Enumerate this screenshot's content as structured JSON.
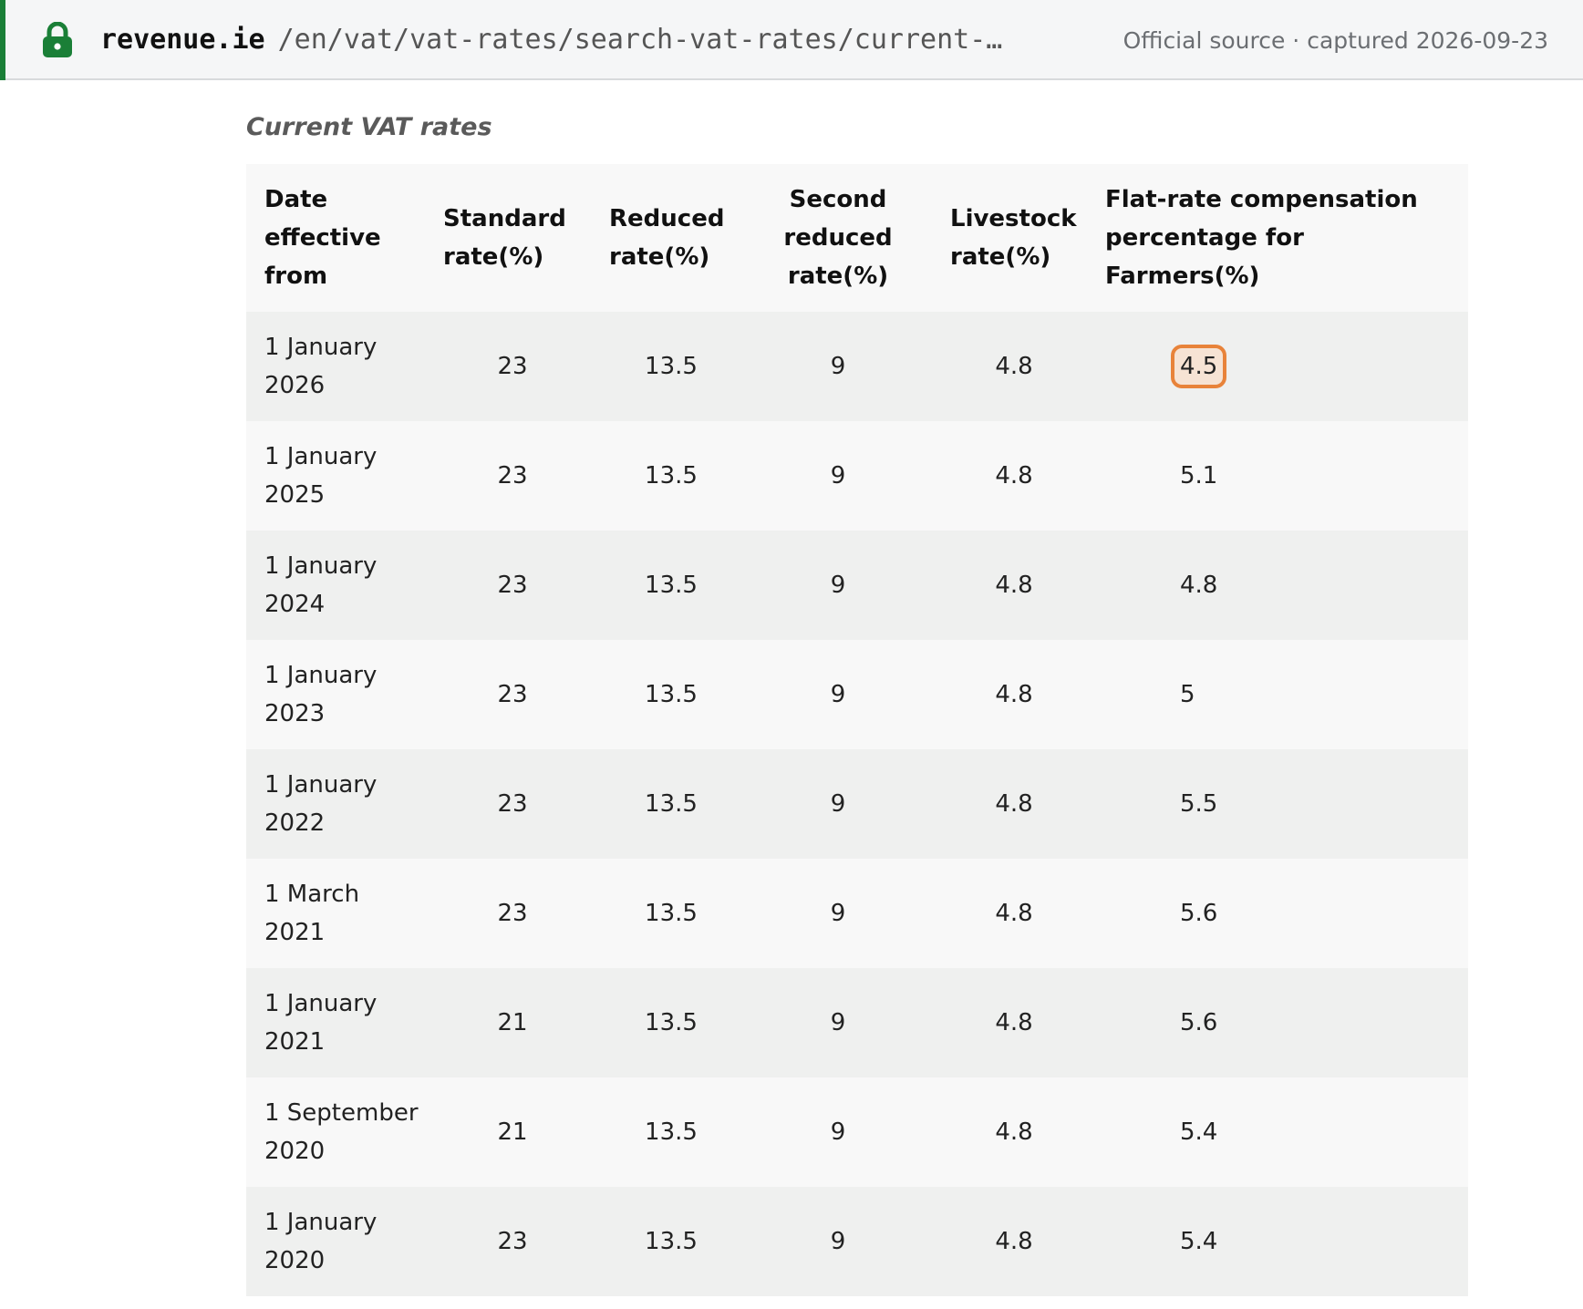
{
  "urlbar": {
    "domain": "revenue.ie",
    "path": "/en/vat/vat-rates/search-vat-rates/current-…",
    "source_note": "Official source · captured 2026-09-23",
    "accent_color": "#1a7f37",
    "lock_icon": "lock-icon"
  },
  "caption": "Current VAT rates",
  "table": {
    "headers": [
      "Date\neffective\nfrom",
      "Standard\nrate(%)",
      "Reduced\nrate(%)",
      "Second\nreduced\nrate(%)",
      "Livestock\nrate(%)",
      "Flat-rate compensation\npercentage for\nFarmers(%)"
    ],
    "rows": [
      {
        "date": "1 January\n2026",
        "standard": "23",
        "reduced": "13.5",
        "second_reduced": "9",
        "livestock": "4.8",
        "flat_rate": "4.5"
      },
      {
        "date": "1 January\n2025",
        "standard": "23",
        "reduced": "13.5",
        "second_reduced": "9",
        "livestock": "4.8",
        "flat_rate": "5.1"
      },
      {
        "date": "1 January\n2024",
        "standard": "23",
        "reduced": "13.5",
        "second_reduced": "9",
        "livestock": "4.8",
        "flat_rate": "4.8"
      },
      {
        "date": "1 January\n2023",
        "standard": "23",
        "reduced": "13.5",
        "second_reduced": "9",
        "livestock": "4.8",
        "flat_rate": "5"
      },
      {
        "date": "1 January\n2022",
        "standard": "23",
        "reduced": "13.5",
        "second_reduced": "9",
        "livestock": "4.8",
        "flat_rate": "5.5"
      },
      {
        "date": "1 March\n2021",
        "standard": "23",
        "reduced": "13.5",
        "second_reduced": "9",
        "livestock": "4.8",
        "flat_rate": "5.6"
      },
      {
        "date": "1  January\n2021",
        "standard": "21",
        "reduced": "13.5",
        "second_reduced": "9",
        "livestock": "4.8",
        "flat_rate": "5.6"
      },
      {
        "date": "1 September\n2020",
        "standard": "21",
        "reduced": "13.5",
        "second_reduced": "9",
        "livestock": "4.8",
        "flat_rate": "5.4"
      },
      {
        "date": "1 January\n2020",
        "standard": "23",
        "reduced": "13.5",
        "second_reduced": "9",
        "livestock": "4.8",
        "flat_rate": "5.4"
      }
    ],
    "highlight_color": "#e8833a"
  }
}
